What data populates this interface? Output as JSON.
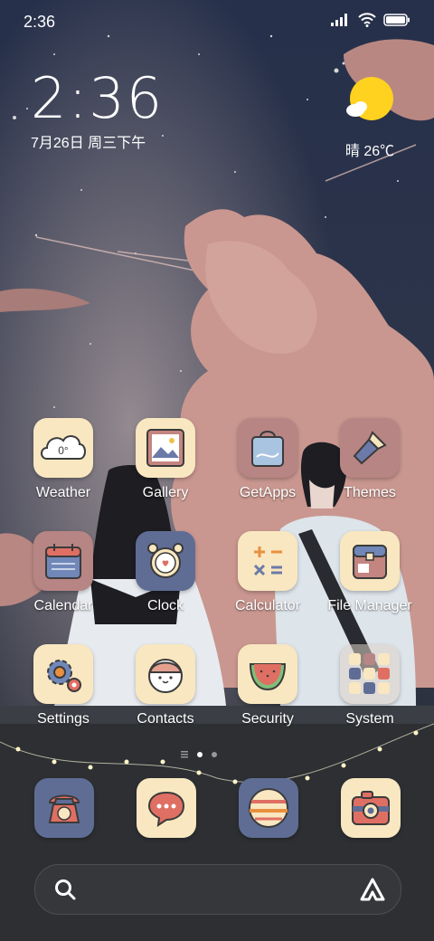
{
  "status_bar": {
    "time": "2:36"
  },
  "clock_widget": {
    "time": "2:36",
    "date": "7月26日 周三下午"
  },
  "weather_widget": {
    "summary": "晴 26℃",
    "icon": "sun-cloud-icon"
  },
  "apps": [
    {
      "name": "weather",
      "label": "Weather",
      "icon": "cloud-temperature-icon",
      "icon_text": "0°"
    },
    {
      "name": "gallery",
      "label": "Gallery",
      "icon": "picture-frame-icon"
    },
    {
      "name": "getapps",
      "label": "GetApps",
      "icon": "shopping-bag-icon"
    },
    {
      "name": "themes",
      "label": "Themes",
      "icon": "paint-brush-icon"
    },
    {
      "name": "calendar",
      "label": "Calendar",
      "icon": "calendar-icon"
    },
    {
      "name": "clock",
      "label": "Clock",
      "icon": "alarm-clock-icon"
    },
    {
      "name": "calculator",
      "label": "Calculator",
      "icon": "calculator-icon"
    },
    {
      "name": "file-manager",
      "label": "File Manager",
      "icon": "folder-bag-icon"
    },
    {
      "name": "settings",
      "label": "Settings",
      "icon": "gear-icon"
    },
    {
      "name": "contacts",
      "label": "Contacts",
      "icon": "contact-face-icon"
    },
    {
      "name": "security",
      "label": "Security",
      "icon": "watermelon-shield-icon"
    },
    {
      "name": "system",
      "label": "System",
      "icon": "folder-icon"
    }
  ],
  "dock": [
    {
      "name": "phone",
      "icon": "telephone-icon"
    },
    {
      "name": "messages",
      "icon": "chat-bubble-icon"
    },
    {
      "name": "browser",
      "icon": "planet-icon"
    },
    {
      "name": "camera",
      "icon": "camera-icon"
    }
  ],
  "page_indicator": {
    "pages": 3,
    "current": 2
  },
  "colors": {
    "icon_cream": "#f8e7c0",
    "icon_rose": "#b78584",
    "icon_blue": "#5f6d95",
    "sky": "#2b3246",
    "cloud_pink": "#c9978f"
  }
}
